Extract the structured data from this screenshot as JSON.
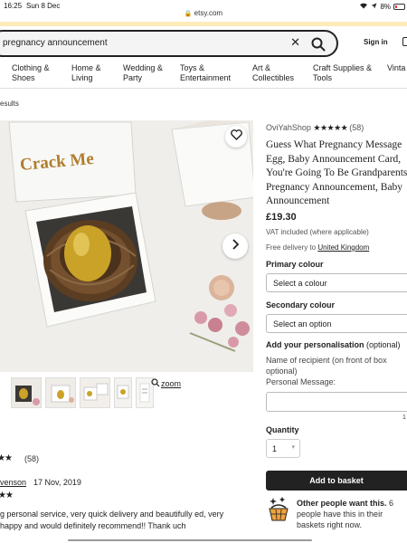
{
  "status_bar": {
    "time": "16:25",
    "date": "Sun 8 Dec",
    "url": "etsy.com",
    "battery": "8%"
  },
  "search": {
    "query": "pregnancy announcement"
  },
  "header": {
    "signin_label": "Sign in"
  },
  "categories": [
    "Clothing &\nShoes",
    "Home &\nLiving",
    "Wedding &\nParty",
    "Toys &\nEntertainment",
    "Art &\nCollectibles",
    "Craft Supplies &\nTools",
    "Vinta"
  ],
  "results_label": "esults",
  "gallery": {
    "image_text": "Crack Me",
    "zoom_label": "zoom"
  },
  "reviews": {
    "count": "(58)",
    "first_review": {
      "reviewer": "venson",
      "date": "17 Nov, 2019",
      "text": "g personal service, very quick delivery and beautifully ed, very happy and would definitely recommend!! Thank uch"
    }
  },
  "listing": {
    "shop_name": "OviYahShop",
    "rating_count": "(58)",
    "title": "Guess What Pregnancy Message Egg, Baby Announcement Card, You're Going To Be Grandparents, Pregnancy Announcement, Baby Announcement",
    "price": "£19.30",
    "vat_note": "VAT included (where applicable)",
    "delivery_prefix": "Free delivery to",
    "delivery_destination": "United Kingdom"
  },
  "options": {
    "primary_colour_label": "Primary colour",
    "primary_colour_value": "Select a colour",
    "secondary_colour_label": "Secondary colour",
    "secondary_colour_value": "Select an option",
    "personalisation_label": "Add your personalisation",
    "personalisation_optional": "(optional)",
    "personalisation_help": "Name of recipient (on front of box optional)\nPersonal Message:",
    "char_count": "1",
    "quantity_label": "Quantity",
    "quantity_value": "1"
  },
  "actions": {
    "add_to_basket": "Add to basket"
  },
  "social_proof": {
    "headline": "Other people want this.",
    "detail": " 6 people have this in their baskets right now."
  },
  "colors": {
    "promo_strip": "#fdebb8",
    "button_bg": "#222222",
    "egg_gold": "#c9a227"
  }
}
